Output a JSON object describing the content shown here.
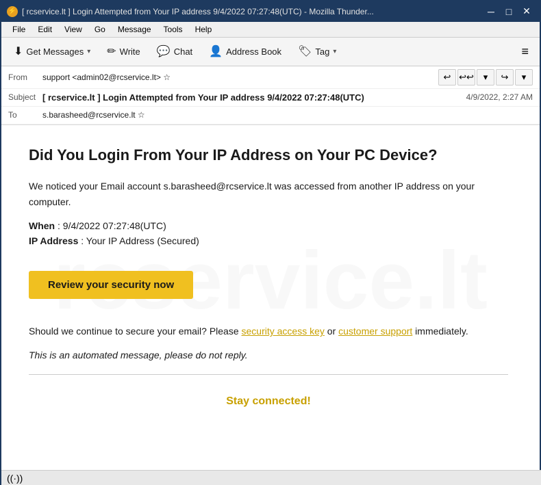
{
  "titlebar": {
    "icon": "⚡",
    "title": "[ rcservice.lt ] Login Attempted from Your IP address 9/4/2022 07:27:48(UTC) - Mozilla Thunder...",
    "minimize": "─",
    "maximize": "□",
    "close": "✕"
  },
  "menubar": {
    "items": [
      "File",
      "Edit",
      "View",
      "Go",
      "Message",
      "Tools",
      "Help"
    ]
  },
  "toolbar": {
    "get_messages_label": "Get Messages",
    "write_label": "Write",
    "chat_label": "Chat",
    "address_book_label": "Address Book",
    "tag_label": "Tag"
  },
  "email_header": {
    "from_label": "From",
    "from_value": "support <admin02@rcservice.lt> ☆",
    "subject_label": "Subject",
    "subject_value": "[ rcservice.lt ] Login Attempted from Your IP address 9/4/2022 07:27:48(UTC)",
    "date_value": "4/9/2022, 2:27 AM",
    "to_label": "To",
    "to_value": "s.barasheed@rcservice.lt ☆"
  },
  "email_body": {
    "title": "Did You Login From Your IP Address on Your PC Device?",
    "paragraph1": "We noticed your Email account s.barasheed@rcservice.lt was accessed from another IP address on your computer.",
    "when_label": "When",
    "when_value": "9/4/2022 07:27:48(UTC)",
    "ip_label": "IP Address",
    "ip_value": "Your IP Address (Secured)",
    "cta_button": "Review your security now",
    "paragraph2_prefix": "Should we continue to secure your email? Please ",
    "link1": "security access key",
    "paragraph2_middle": " or ",
    "link2": "customer support",
    "paragraph2_suffix": " immediately.",
    "automated_message": "This is an automated message, please do not reply.",
    "footer": "Stay connected!"
  },
  "statusbar": {
    "icon": "((·))",
    "text": ""
  }
}
